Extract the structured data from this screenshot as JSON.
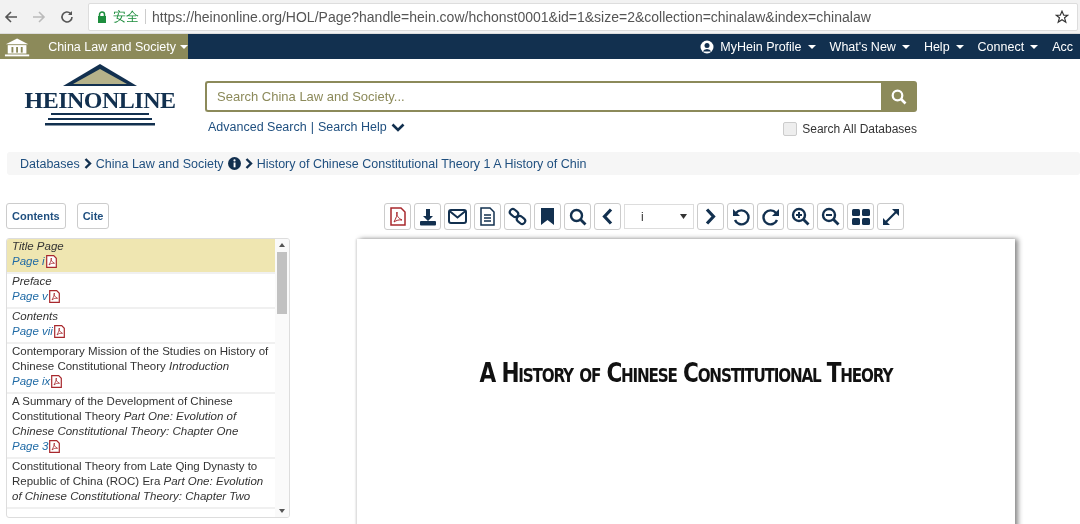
{
  "browser": {
    "security_label": "安全",
    "url": "https://heinonline.org/HOL/Page?handle=hein.cow/hchonst0001&id=1&size=2&collection=chinalaw&index=chinalaw"
  },
  "nav": {
    "collection": "China Law and Society",
    "menu": [
      {
        "label": "MyHein Profile",
        "kind": "profile"
      },
      {
        "label": "What's New",
        "kind": "dropdown"
      },
      {
        "label": "Help",
        "kind": "dropdown"
      },
      {
        "label": "Connect",
        "kind": "dropdown"
      },
      {
        "label": "Acc",
        "kind": "plain"
      }
    ]
  },
  "logo": {
    "text": "HEINONLINE"
  },
  "search": {
    "placeholder": "Search China Law and Society...",
    "links": [
      "Advanced Search",
      "Search Help"
    ],
    "link_separator": "|",
    "search_all": {
      "label": "Search All Databases",
      "checked": false
    }
  },
  "breadcrumb": [
    {
      "label": "Databases",
      "info": false
    },
    {
      "label": "China Law and Society",
      "info": true
    },
    {
      "label": "History of Chinese Constitutional Theory 1 A History of Chin",
      "info": false
    }
  ],
  "side_buttons": [
    "Contents",
    "Cite"
  ],
  "toolbar": {
    "page_value": "i"
  },
  "toc": {
    "items": [
      {
        "kind": "front",
        "title": "Title Page",
        "page": "Page i",
        "selected": true
      },
      {
        "kind": "front",
        "title": "Preface",
        "page": "Page v",
        "selected": false
      },
      {
        "kind": "front",
        "title": "Contents",
        "page": "Page vii",
        "selected": false
      },
      {
        "kind": "chapter",
        "title": "Contemporary Mission of the Studies on History of Chinese Constitutional Theory",
        "part": "Introduction",
        "page": "Page ix",
        "selected": false
      },
      {
        "kind": "chapter",
        "title": "A Summary of the Development of Chinese Constitutional Theory",
        "part": "Part One: Evolution of Chinese Constitutional Theory: Chapter One",
        "page": "Page 3",
        "selected": false
      },
      {
        "kind": "chapter",
        "title": "Constitutional Theory from Late Qing Dynasty to Republic of China (ROC) Era",
        "part": "Part One: Evolution of Chinese Constitutional Theory: Chapter Two",
        "selected": false
      }
    ]
  },
  "document": {
    "title": "A History of Chinese Constitutional Theory"
  }
}
